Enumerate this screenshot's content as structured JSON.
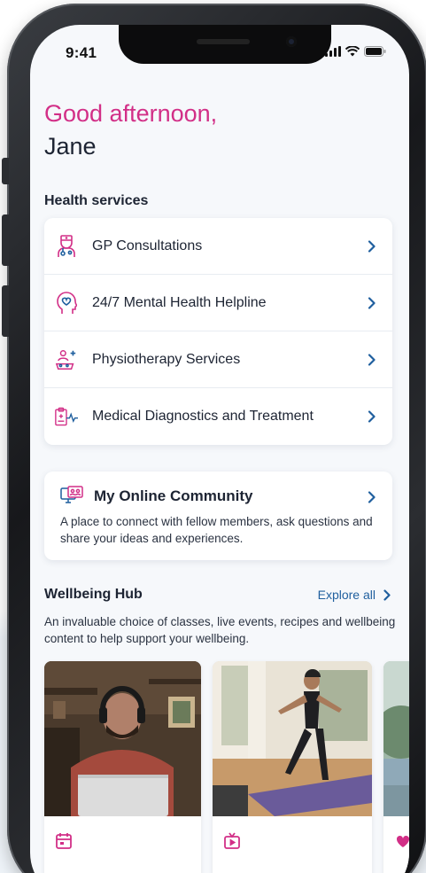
{
  "status_bar": {
    "time": "9:41"
  },
  "greeting": {
    "line1": "Good afternoon,",
    "line2": "Jane"
  },
  "health_services": {
    "title": "Health services",
    "items": [
      {
        "label": "GP Consultations",
        "icon": "doctor-icon"
      },
      {
        "label": "24/7 Mental Health Helpline",
        "icon": "mental-health-icon"
      },
      {
        "label": "Physiotherapy Services",
        "icon": "physiotherapy-icon"
      },
      {
        "label": "Medical Diagnostics and Treatment",
        "icon": "diagnostics-icon"
      }
    ]
  },
  "community": {
    "title": "My Online Community",
    "description": "A place to connect with fellow members, ask questions and share your ideas and experiences.",
    "icon": "community-icon"
  },
  "wellbeing_hub": {
    "title": "Wellbeing Hub",
    "explore_label": "Explore all",
    "description": "An invaluable choice of classes, live events, recipes and wellbeing content to help support your wellbeing.",
    "tiles": [
      {
        "image": "man-with-headphones-laptop",
        "icon": "calendar-icon"
      },
      {
        "image": "woman-exercising-yoga-mat",
        "icon": "video-icon"
      },
      {
        "image": "outdoor-landscape",
        "icon": "heart-icon"
      }
    ]
  },
  "colors": {
    "accent": "#d22f87",
    "link": "#1f5f9e",
    "text": "#1d2433"
  }
}
